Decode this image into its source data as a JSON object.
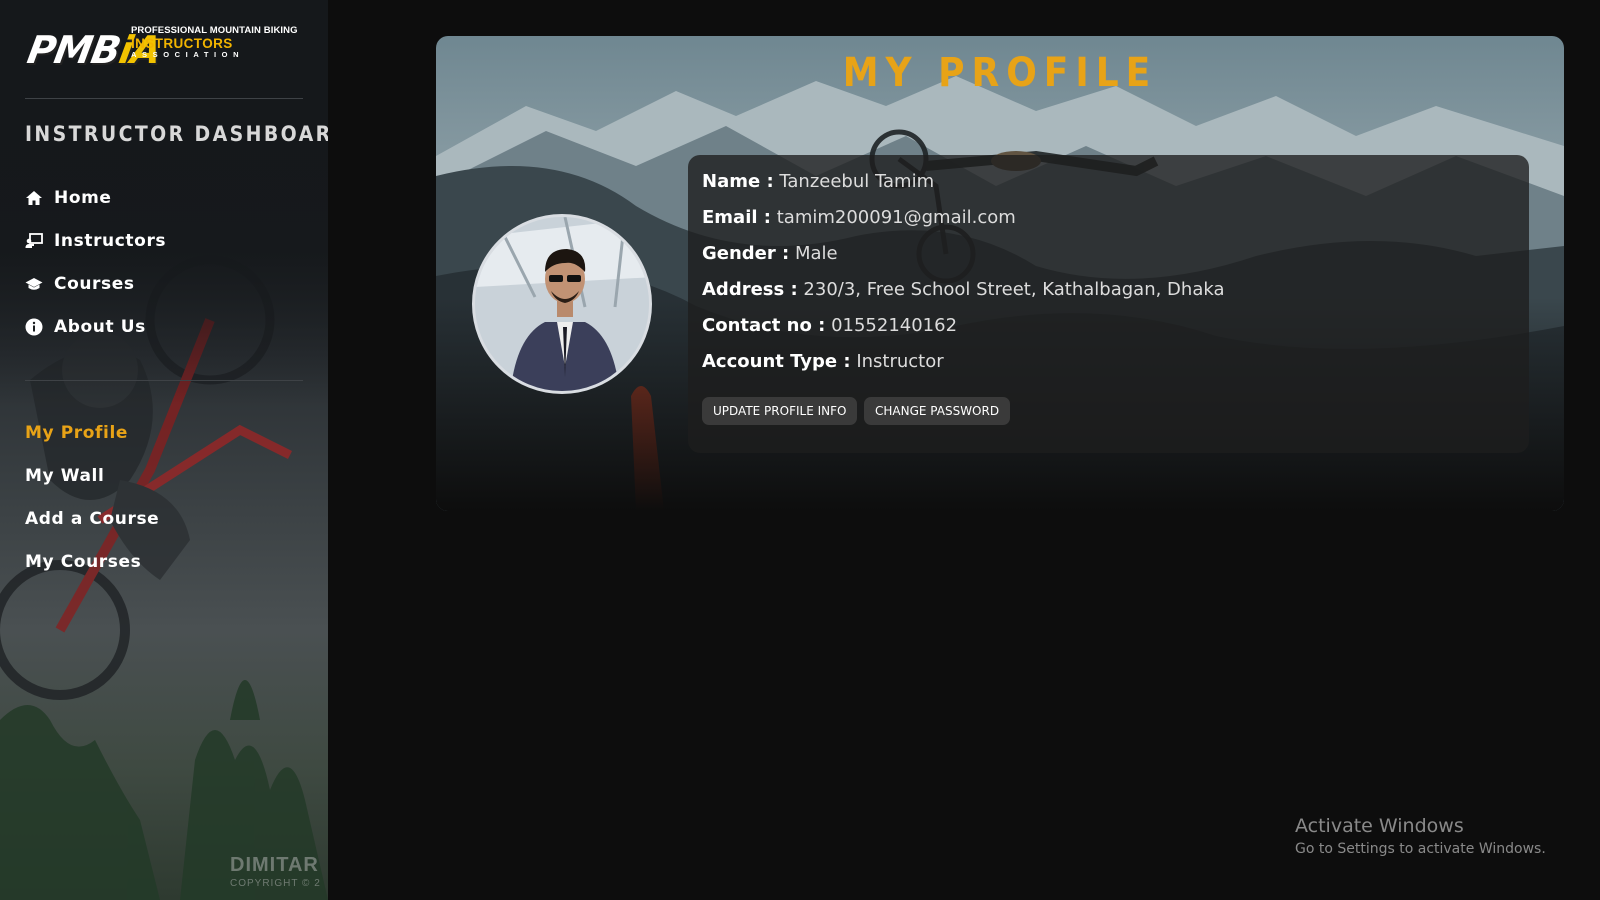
{
  "logo": {
    "mark_left": "PMB",
    "mark_accent": "iA",
    "line1": "PROFESSIONAL MOUNTAIN BIKING",
    "line2": "INSTRUCTORS",
    "line3": "ASSOCIATION"
  },
  "sidebar": {
    "title": "INSTRUCTOR DASHBOARD",
    "main_nav": [
      {
        "label": "Home",
        "icon": "home-icon"
      },
      {
        "label": "Instructors",
        "icon": "chalkboard-teacher-icon"
      },
      {
        "label": "Courses",
        "icon": "graduation-cap-icon"
      },
      {
        "label": "About Us",
        "icon": "info-circle-icon"
      }
    ],
    "account_nav": [
      {
        "label": "My Profile",
        "active": true
      },
      {
        "label": "My Wall",
        "active": false
      },
      {
        "label": "Add a Course",
        "active": false
      },
      {
        "label": "My Courses",
        "active": false
      }
    ],
    "watermark": "DIMITAR",
    "watermark_sub": "COPYRIGHT © 2"
  },
  "profile": {
    "page_title": "MY PROFILE",
    "fields": [
      {
        "label": "Name :",
        "value": "Tanzeebul Tamim"
      },
      {
        "label": "Email :",
        "value": "tamim200091@gmail.com"
      },
      {
        "label": "Gender :",
        "value": "Male"
      },
      {
        "label": "Address :",
        "value": "230/3, Free School Street, Kathalbagan, Dhaka"
      },
      {
        "label": "Contact no :",
        "value": "01552140162"
      },
      {
        "label": "Account Type :",
        "value": "Instructor"
      }
    ],
    "buttons": {
      "update": "UPDATE PROFILE INFO",
      "change_password": "CHANGE PASSWORD"
    }
  },
  "os_notice": {
    "title": "Activate Windows",
    "subtitle": "Go to Settings to activate Windows."
  },
  "colors": {
    "accent": "#e8a317",
    "background": "#0d0d0d",
    "card": "#1e1e1e",
    "button": "#3a3a3a"
  }
}
